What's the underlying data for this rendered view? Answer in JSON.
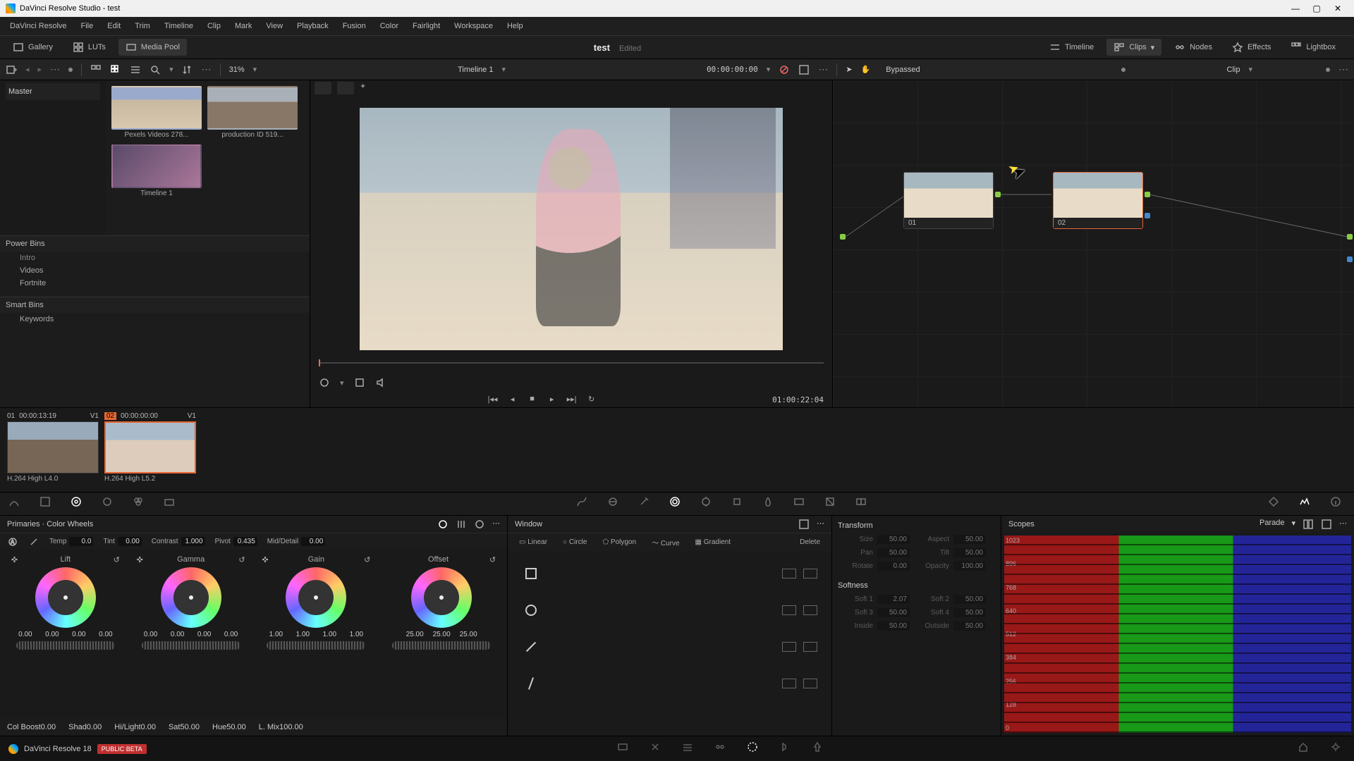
{
  "title": "DaVinci Resolve Studio - test",
  "menubar": [
    "DaVinci Resolve",
    "File",
    "Edit",
    "Trim",
    "Timeline",
    "Clip",
    "Mark",
    "View",
    "Playback",
    "Fusion",
    "Color",
    "Fairlight",
    "Workspace",
    "Help"
  ],
  "toptoolbar": {
    "gallery": "Gallery",
    "luts": "LUTs",
    "mediapool": "Media Pool",
    "project": "test",
    "edited": "Edited",
    "timeline": "Timeline",
    "clips": "Clips",
    "nodes": "Nodes",
    "effects": "Effects",
    "lightbox": "Lightbox"
  },
  "secbar": {
    "zoom": "31%",
    "timeline_name": "Timeline 1",
    "timecode": "00:00:00:00",
    "bypass": "Bypassed",
    "mode": "Clip"
  },
  "mediapool": {
    "master": "Master",
    "thumbs": [
      {
        "label": "Pexels Videos 278..."
      },
      {
        "label": "production ID 519..."
      },
      {
        "label": "Timeline 1"
      }
    ],
    "powerbins": "Power Bins",
    "powerbins_items": [
      "Intro",
      "Videos",
      "Fortnite"
    ],
    "smartbins": "Smart Bins",
    "smartbins_items": [
      "Keywords"
    ]
  },
  "viewer": {
    "rec_time": "01:00:22:04"
  },
  "tlclips": [
    {
      "num": "01",
      "tc": "00:00:13:19",
      "trk": "V1",
      "codec": "H.264 High L4.0"
    },
    {
      "num": "02",
      "tc": "00:00:00:00",
      "trk": "V1",
      "codec": "H.264 High L5.2"
    }
  ],
  "nodes": [
    {
      "label": "01"
    },
    {
      "label": "02"
    }
  ],
  "primaries": {
    "title": "Primaries · Color Wheels",
    "row1": {
      "temp_lbl": "Temp",
      "temp": "0.0",
      "tint_lbl": "Tint",
      "tint": "0.00",
      "contrast_lbl": "Contrast",
      "contrast": "1.000",
      "pivot_lbl": "Pivot",
      "pivot": "0.435",
      "md_lbl": "Mid/Detail",
      "md": "0.00"
    },
    "wheels": [
      {
        "name": "Lift",
        "vals": [
          "0.00",
          "0.00",
          "0.00",
          "0.00"
        ]
      },
      {
        "name": "Gamma",
        "vals": [
          "0.00",
          "0.00",
          "0.00",
          "0.00"
        ]
      },
      {
        "name": "Gain",
        "vals": [
          "1.00",
          "1.00",
          "1.00",
          "1.00"
        ]
      },
      {
        "name": "Offset",
        "vals": [
          "25.00",
          "25.00",
          "25.00"
        ]
      }
    ],
    "row2": {
      "cb_lbl": "Col Boost",
      "cb": "0.00",
      "shad_lbl": "Shad",
      "shad": "0.00",
      "hl_lbl": "Hi/Light",
      "hl": "0.00",
      "sat_lbl": "Sat",
      "sat": "50.00",
      "hue_lbl": "Hue",
      "hue": "50.00",
      "lmix_lbl": "L. Mix",
      "lmix": "100.00"
    }
  },
  "window": {
    "title": "Window",
    "tools": [
      "Linear",
      "Circle",
      "Polygon",
      "Curve",
      "Gradient"
    ],
    "delete": "Delete"
  },
  "transform": {
    "title": "Transform",
    "rows": [
      {
        "l1": "Size",
        "v1": "50.00",
        "l2": "Aspect",
        "v2": "50.00"
      },
      {
        "l1": "Pan",
        "v1": "50.00",
        "l2": "Tilt",
        "v2": "50.00"
      },
      {
        "l1": "Rotate",
        "v1": "0.00",
        "l2": "Opacity",
        "v2": "100.00"
      }
    ],
    "soft_title": "Softness",
    "soft_rows": [
      {
        "l1": "Soft 1",
        "v1": "2.07",
        "l2": "Soft 2",
        "v2": "50.00"
      },
      {
        "l1": "Soft 3",
        "v1": "50.00",
        "l2": "Soft 4",
        "v2": "50.00"
      },
      {
        "l1": "Inside",
        "v1": "50.00",
        "l2": "Outside",
        "v2": "50.00"
      }
    ]
  },
  "scopes": {
    "title": "Scopes",
    "mode": "Parade",
    "ticks": [
      "1023",
      "896",
      "768",
      "640",
      "512",
      "384",
      "256",
      "128",
      "0"
    ]
  },
  "footer": {
    "app": "DaVinci Resolve 18",
    "beta": "PUBLIC BETA"
  }
}
